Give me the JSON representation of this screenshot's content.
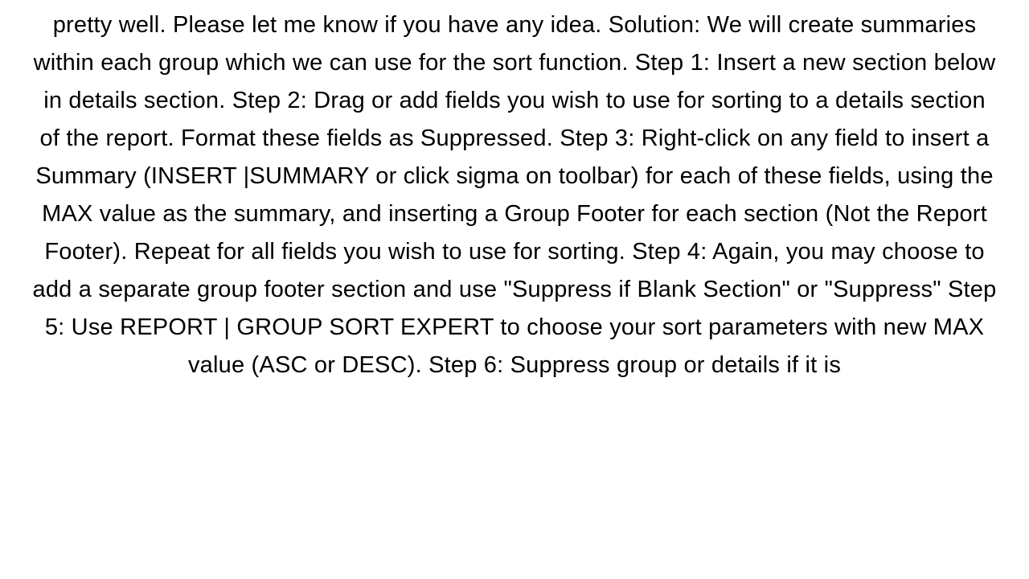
{
  "document": {
    "body": "pretty well. Please let me know if you have any idea. Solution: We will create summaries within each group which we can use for the sort function.  Step 1: Insert a new section below in details section. Step 2: Drag or add fields you wish to use for sorting to a details section of the report. Format these fields as Suppressed. Step 3: Right-click on any field to insert a Summary (INSERT |SUMMARY or click sigma on toolbar) for each of these fields, using the MAX value as the summary, and inserting a Group Footer for each section (Not the Report Footer). Repeat for all fields you wish to use for sorting. Step 4: Again, you may choose to add a separate group footer section and use \"Suppress if Blank Section\" or \"Suppress\" Step 5: Use REPORT | GROUP SORT EXPERT to choose your sort parameters with new MAX value (ASC or DESC). Step 6: Suppress group or details if it is"
  }
}
